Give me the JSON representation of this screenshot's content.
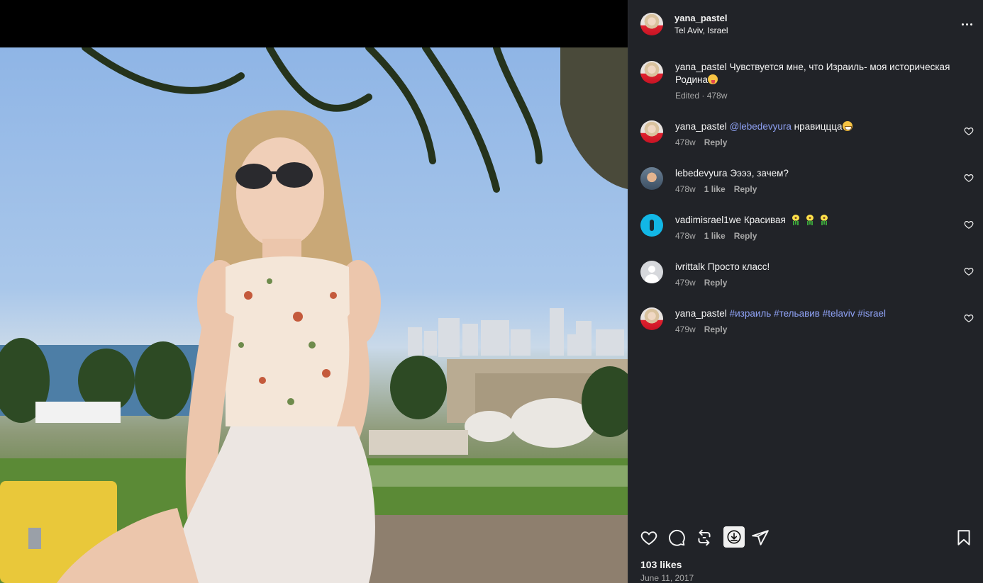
{
  "post": {
    "username": "yana_pastel",
    "location": "Tel Aviv, Israel",
    "likes": "103 likes",
    "date": "June 11, 2017"
  },
  "caption": {
    "username": "yana_pastel",
    "text": "Чувствуется мне, что Израиль- моя историческая Родина",
    "emoji": "tongue-face-emoji",
    "meta": "Edited · 478w"
  },
  "comments": [
    {
      "username": "yana_pastel",
      "mention": "@lebedevyura",
      "text": "нравиццца",
      "emoji": "grin-emoji",
      "time": "478w",
      "likes": "",
      "reply": "Reply",
      "avatar": "yana"
    },
    {
      "username": "lebedevyura",
      "mention": "",
      "text": "Ээээ, зачем?",
      "emoji": "",
      "time": "478w",
      "likes": "1 like",
      "reply": "Reply",
      "avatar": "lebe"
    },
    {
      "username": "vadimisrael1we",
      "mention": "",
      "text": "Красивая",
      "emoji": "flower-emoji",
      "time": "478w",
      "likes": "1 like",
      "reply": "Reply",
      "avatar": "vadim"
    },
    {
      "username": "ivrittalk",
      "mention": "",
      "text": "Просто класс!",
      "emoji": "",
      "time": "479w",
      "likes": "",
      "reply": "Reply",
      "avatar": "ivrit"
    },
    {
      "username": "yana_pastel",
      "mention": "",
      "text": "",
      "hashtags": [
        "#израиль",
        "#тельавив",
        "#telaviv",
        "#israel"
      ],
      "emoji": "",
      "time": "479w",
      "likes": "",
      "reply": "Reply",
      "avatar": "yana"
    }
  ],
  "icons": {
    "like": "heart-icon",
    "comment": "comment-icon",
    "repost": "repost-icon",
    "download": "download-icon",
    "share": "share-icon",
    "save": "bookmark-icon",
    "more": "more-options-icon"
  },
  "colors": {
    "sidebar_bg": "#212328",
    "link": "#8fa2f5",
    "muted": "#a8a8a8"
  }
}
